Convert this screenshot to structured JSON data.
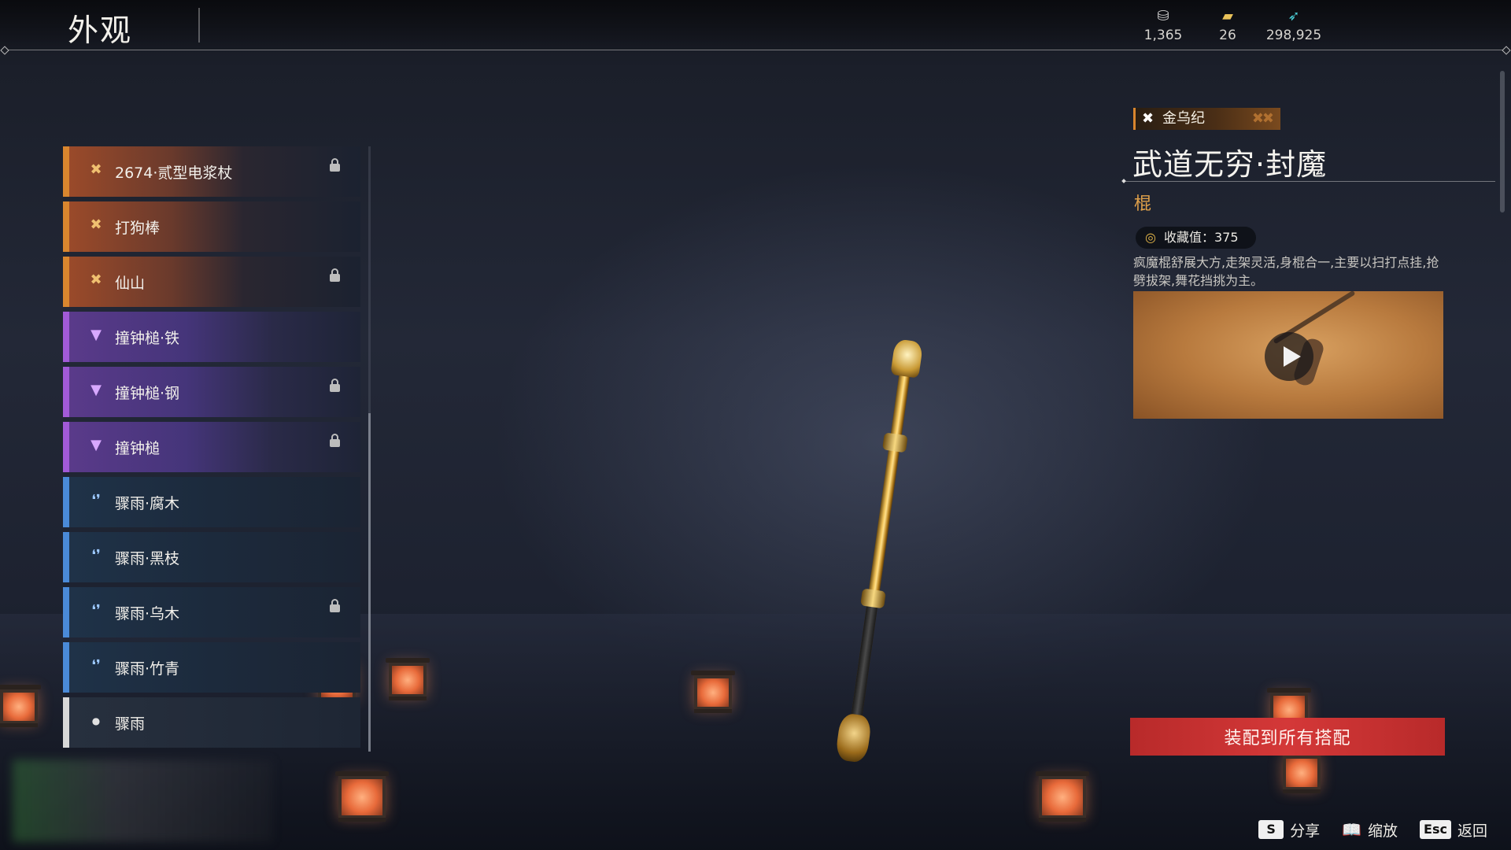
{
  "header": {
    "title": "外观",
    "currencies": [
      {
        "icon": "coin-stack-icon",
        "value": "1,365"
      },
      {
        "icon": "ticket-icon",
        "value": "26"
      },
      {
        "icon": "feather-icon",
        "value": "298,925"
      }
    ]
  },
  "weapon_list": [
    {
      "name": "2674·贰型电浆杖",
      "rarity": "orange",
      "rarity_icon": "legendary-icon",
      "locked": true
    },
    {
      "name": "打狗棒",
      "rarity": "orange",
      "rarity_icon": "legendary-icon",
      "locked": false
    },
    {
      "name": "仙山",
      "rarity": "orange",
      "rarity_icon": "legendary-icon",
      "locked": true
    },
    {
      "name": "撞钟槌·铁",
      "rarity": "purple",
      "rarity_icon": "epic-icon",
      "locked": false
    },
    {
      "name": "撞钟槌·钢",
      "rarity": "purple",
      "rarity_icon": "epic-icon",
      "locked": true
    },
    {
      "name": "撞钟槌",
      "rarity": "purple",
      "rarity_icon": "epic-icon",
      "locked": true
    },
    {
      "name": "骤雨·腐木",
      "rarity": "blue",
      "rarity_icon": "rare-icon",
      "locked": false
    },
    {
      "name": "骤雨·黑枝",
      "rarity": "blue",
      "rarity_icon": "rare-icon",
      "locked": false
    },
    {
      "name": "骤雨·乌木",
      "rarity": "blue",
      "rarity_icon": "rare-icon",
      "locked": true
    },
    {
      "name": "骤雨·竹青",
      "rarity": "blue",
      "rarity_icon": "rare-icon",
      "locked": false
    },
    {
      "name": "骤雨",
      "rarity": "white",
      "rarity_icon": "common-icon",
      "locked": false
    }
  ],
  "detail": {
    "series": "金乌纪",
    "weapon_name": "武道无穷·封魔",
    "weapon_type": "棍",
    "collection_label": "收藏值：375",
    "description": "疯魔棍舒展大方,走架灵活,身棍合一,主要以扫打点挂,抢劈拔架,舞花挡挑为主。",
    "equip_button": "装配到所有搭配"
  },
  "hotkeys": [
    {
      "key": "S",
      "label": "分享"
    },
    {
      "key": "",
      "label": "缩放"
    },
    {
      "key": "Esc",
      "label": "返回"
    }
  ],
  "colors": {
    "legendary": "#d9862e",
    "epic": "#a25ad8",
    "rare": "#4a8ad8",
    "common": "#d8d8d8",
    "equip_button": "#d43838",
    "weapon_type": "#e2a24a"
  }
}
